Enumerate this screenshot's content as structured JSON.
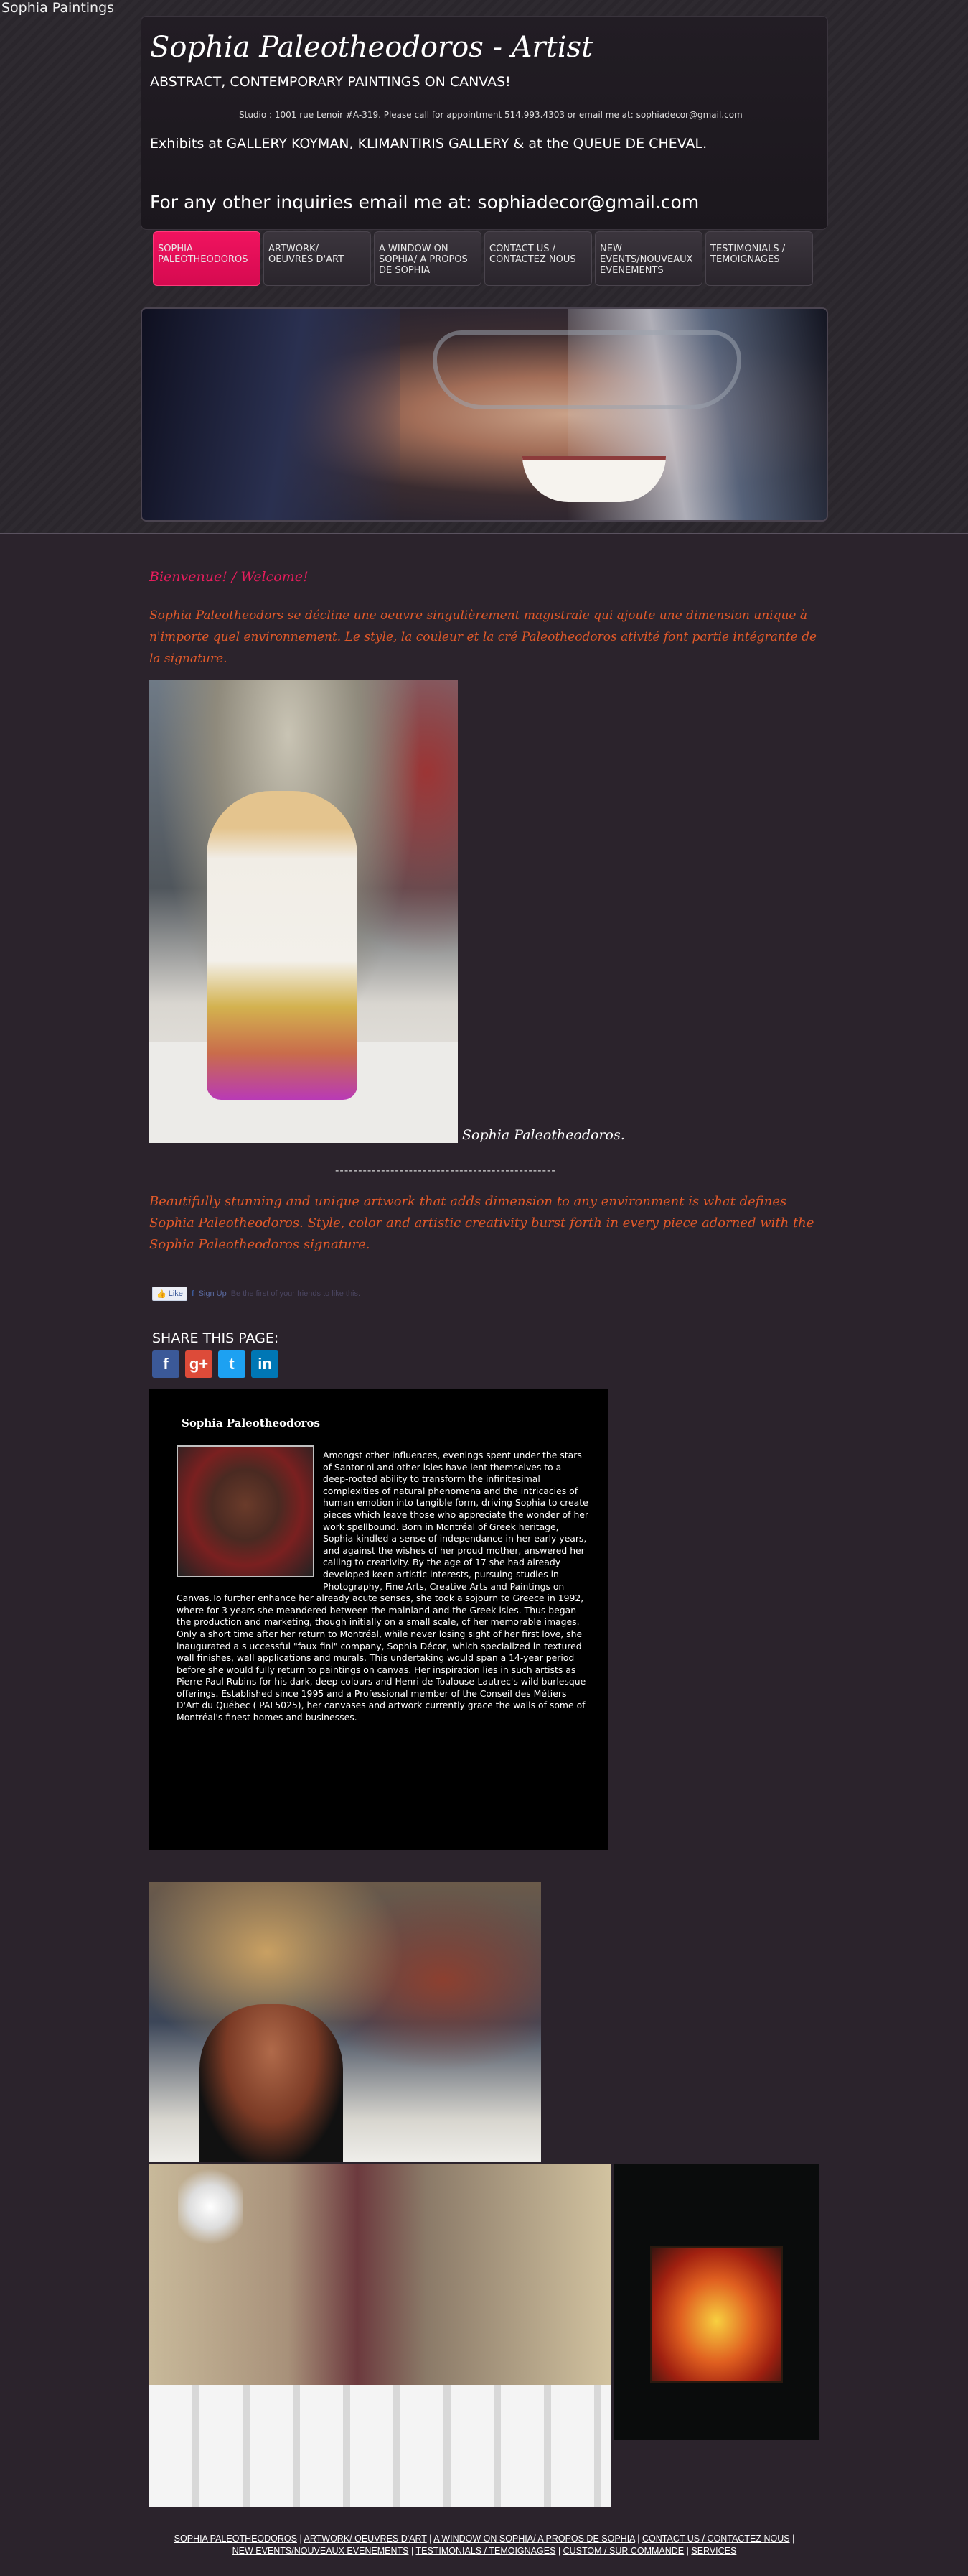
{
  "page": {
    "site_name": "Sophia Paintings"
  },
  "header": {
    "title": "Sophia Paleotheodoros - Artist",
    "subtitle": "ABSTRACT, CONTEMPORARY PAINTINGS ON CANVAS!",
    "studio": "Studio : 1001 rue Lenoir #A-319. Please call for appointment 514.993.4303 or email me at: sophiadecor@gmail.com",
    "exhibits": "Exhibits at GALLERY KOYMAN, KLIMANTIRIS GALLERY & at the QUEUE DE CHEVAL.",
    "inquiry": "For any other inquiries email me at: sophiadecor@gmail.com"
  },
  "nav": {
    "items": [
      {
        "label": "SOPHIA PALEOTHEODOROS",
        "active": true
      },
      {
        "label": "ARTWORK/ OEUVRES D'ART"
      },
      {
        "label": "A WINDOW ON SOPHIA/ A PROPOS DE SOPHIA"
      },
      {
        "label": "CONTACT US / CONTACTEZ NOUS"
      },
      {
        "label": "NEW EVENTS/NOUVEAUX EVENEMENTS"
      },
      {
        "label": "TESTIMONIALS / TEMOIGNAGES"
      }
    ]
  },
  "main": {
    "welcome": "Bienvenue! / Welcome!",
    "intro_fr": "Sophia Paleotheodors se décline une oeuvre singulièrement magistrale qui ajoute une dimension unique à n'importe quel environnement. Le style, la couleur et la cré Paleotheodoros ativité font partie intégrante de la signature.",
    "photo_caption": "Sophia Paleotheodoros.",
    "separator": "------------------------------------------------",
    "intro_en": "Beautifully stunning and unique artwork that adds dimension to any environment is what defines Sophia Paleotheodoros. Style, color and artistic creativity burst forth in every piece adorned with the Sophia Paleotheodoros signature.",
    "like_label": "Like",
    "like_text": "Be the first of your friends to like this.",
    "sign_up_text": "Sign Up"
  },
  "share": {
    "title": "SHARE THIS PAGE:",
    "icons": [
      {
        "name": "facebook",
        "glyph": "f",
        "color": "#3b5998"
      },
      {
        "name": "google-plus",
        "glyph": "g+",
        "color": "#dd4b39"
      },
      {
        "name": "twitter",
        "glyph": "t",
        "color": "#1da1f2"
      },
      {
        "name": "linkedin",
        "glyph": "in",
        "color": "#0077b5"
      }
    ]
  },
  "bio": {
    "title": "Sophia Paleotheodoros",
    "text": "Amongst other influences, evenings spent under the stars of Santorini and other isles have lent themselves to a deep-rooted ability to transform the infinitesimal complexities of natural phenomena and the intricacies of human emotion into tangible form, driving Sophia to create pieces which leave those who appreciate the wonder of her work spellbound. Born in Montréal of Greek heritage, Sophia kindled a sense of independance in her early years, and against the wishes of her proud mother, answered her calling to creativity. By the age of 17 she had already developed keen artistic interests, pursuing studies in Photography, Fine Arts, Creative Arts and Paintings on Canvas.To further enhance her already acute senses, she took a sojourn to Greece in 1992, where for 3 years she meandered between the mainland and the Greek isles. Thus began the production and marketing, though initially on a small scale, of her memorable images. Only a short time after her return to Montréal, while never losing sight of her first love, she inaugurated a s uccessful \"faux fini\" company, Sophia Décor, which specialized in textured wall finishes, wall applications and murals. This undertaking would span a 14-year period before she would fully return to paintings on canvas. Her inspiration lies in such artists as Pierre-Paul Rubins for his dark, deep colours and Henri de Toulouse-Lautrec's wild burlesque offerings. Established since 1995 and a Professional member of the Conseil des Métiers D'Art du Québec ( PAL5025), her canvases and artwork currently grace the walls of some of Montréal's finest homes and businesses."
  },
  "footer": {
    "links": [
      "SOPHIA PALEOTHEODOROS",
      "ARTWORK/ OEUVRES D'ART",
      "A WINDOW ON SOPHIA/ A PROPOS DE SOPHIA",
      "CONTACT US / CONTACTEZ NOUS",
      "NEW EVENTS/NOUVEAUX EVENEMENTS",
      "TESTIMONIALS / TEMOIGNAGES",
      "CUSTOM / SUR COMMANDE",
      "SERVICES"
    ]
  },
  "colors": {
    "background": "#2b232c",
    "accent": "#e51d5c",
    "intro_text": "#e0592a"
  }
}
